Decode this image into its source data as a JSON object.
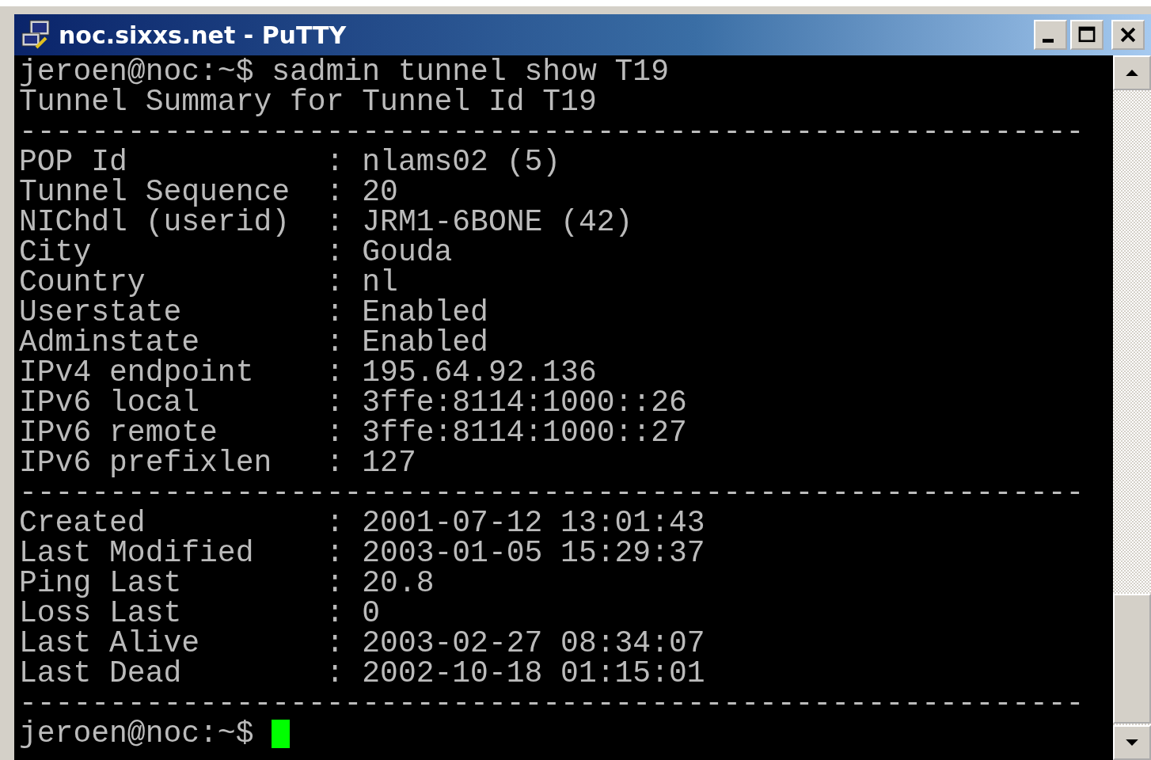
{
  "window": {
    "title": "noc.sixxs.net - PuTTY"
  },
  "lines": [
    {
      "kind": "text",
      "text": "jeroen@noc:~$ sadmin tunnel show T19"
    },
    {
      "kind": "text",
      "text": "Tunnel Summary for Tunnel Id T19"
    },
    {
      "kind": "rule",
      "text": "-----------------------------------------------------------"
    },
    {
      "kind": "text",
      "text": "POP Id           : nlams02 (5)"
    },
    {
      "kind": "text",
      "text": "Tunnel Sequence  : 20"
    },
    {
      "kind": "text",
      "text": "NIChdl (userid)  : JRM1-6BONE (42)"
    },
    {
      "kind": "text",
      "text": "City             : Gouda"
    },
    {
      "kind": "text",
      "text": "Country          : nl"
    },
    {
      "kind": "text",
      "text": "Userstate        : Enabled"
    },
    {
      "kind": "text",
      "text": "Adminstate       : Enabled"
    },
    {
      "kind": "text",
      "text": "IPv4 endpoint    : 195.64.92.136"
    },
    {
      "kind": "text",
      "text": "IPv6 local       : 3ffe:8114:1000::26"
    },
    {
      "kind": "text",
      "text": "IPv6 remote      : 3ffe:8114:1000::27"
    },
    {
      "kind": "text",
      "text": "IPv6 prefixlen   : 127"
    },
    {
      "kind": "rule",
      "text": "-----------------------------------------------------------"
    },
    {
      "kind": "text",
      "text": "Created          : 2001-07-12 13:01:43"
    },
    {
      "kind": "text",
      "text": "Last Modified    : 2003-01-05 15:29:37"
    },
    {
      "kind": "text",
      "text": "Ping Last        : 20.8"
    },
    {
      "kind": "text",
      "text": "Loss Last        : 0"
    },
    {
      "kind": "text",
      "text": "Last Alive       : 2003-02-27 08:34:07"
    },
    {
      "kind": "text",
      "text": "Last Dead        : 2002-10-18 01:15:01"
    },
    {
      "kind": "rule",
      "text": "-----------------------------------------------------------"
    },
    {
      "kind": "prompt",
      "text": "jeroen@noc:~$ "
    }
  ]
}
